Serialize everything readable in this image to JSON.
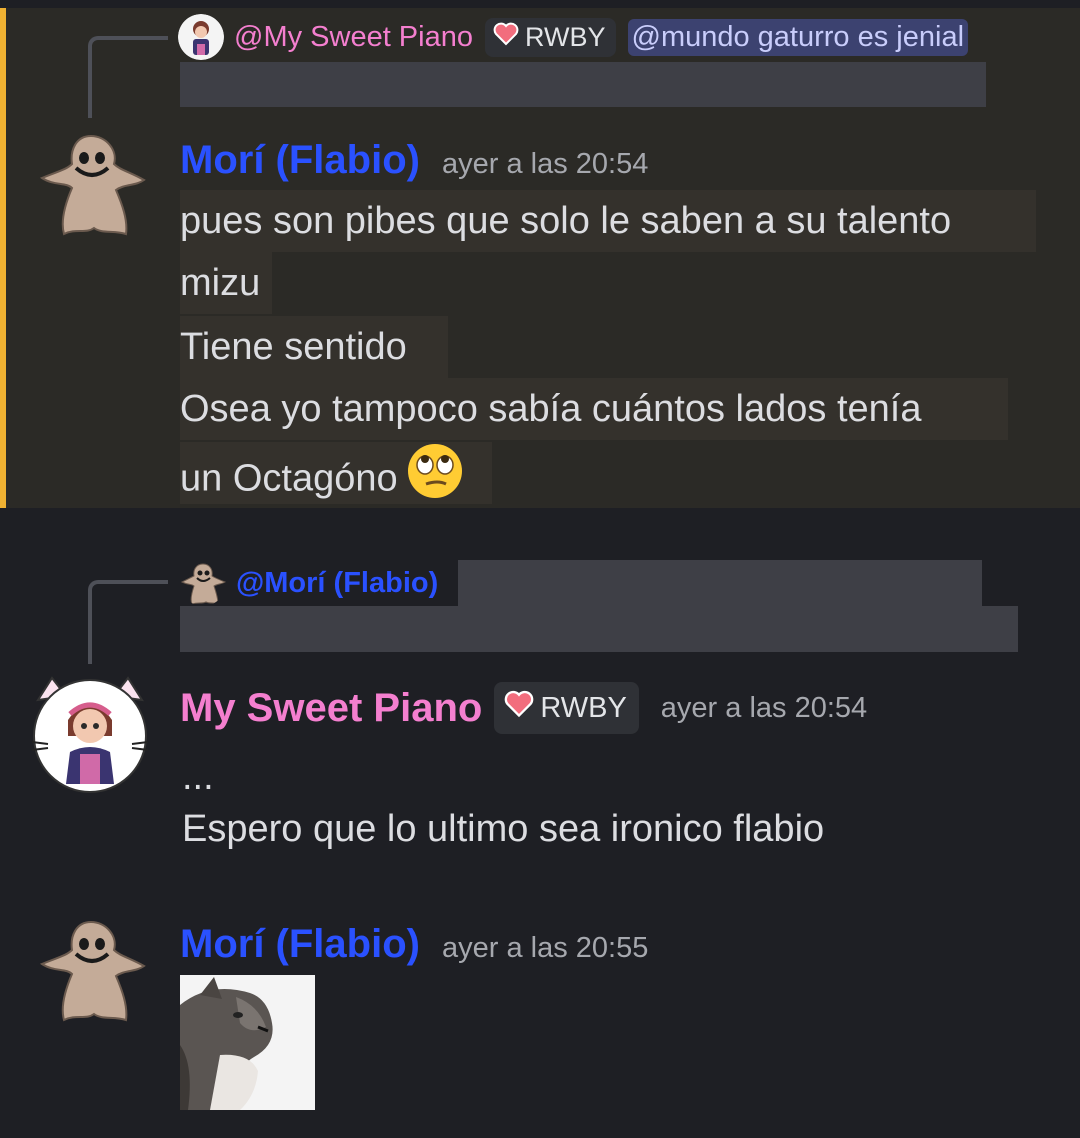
{
  "message1": {
    "reply": {
      "author_mention": "@My Sweet Piano",
      "tag": "RWBY",
      "mention_chip": "@mundo gaturro es jenial"
    },
    "author": "Morí (Flabio)",
    "timestamp": "ayer a las 20:54",
    "lines": [
      "pues son pibes que solo le saben a su talento",
      "mizu",
      "Tiene sentido",
      "Osea yo tampoco sabía cuántos lados tenía",
      "un Octagóno"
    ],
    "emoji": "rolling-eyes-emoji"
  },
  "message2": {
    "reply": {
      "author_mention": "@Morí (Flabio)"
    },
    "author": "My Sweet Piano",
    "tag": "RWBY",
    "timestamp": "ayer a las 20:54",
    "lines": [
      "...",
      "Espero que lo ultimo sea ironico flabio"
    ]
  },
  "message3": {
    "author": "Morí (Flabio)",
    "timestamp": "ayer a las 20:55",
    "attachment": "cat-image"
  },
  "colors": {
    "background": "#1e1f24",
    "highlight": "#2b2a26",
    "highlight_bar": "#f0b232",
    "name_blue": "#2a51ff",
    "name_pink": "#f47fcf"
  }
}
